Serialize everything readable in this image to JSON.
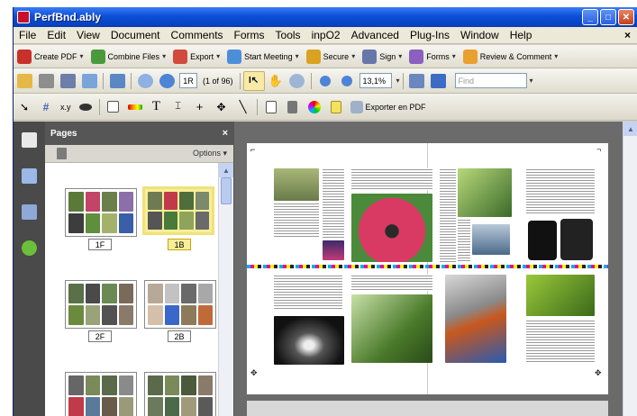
{
  "window": {
    "title": "PerfBnd.ably"
  },
  "menu": [
    "File",
    "Edit",
    "View",
    "Document",
    "Comments",
    "Forms",
    "Tools",
    "inpO2",
    "Advanced",
    "Plug-Ins",
    "Window",
    "Help"
  ],
  "menu_close": "×",
  "toolbar1": {
    "create_pdf": "Create PDF",
    "combine_files": "Combine Files",
    "export": "Export",
    "start_meeting": "Start Meeting",
    "secure": "Secure",
    "sign": "Sign",
    "forms": "Forms",
    "review_comment": "Review & Comment"
  },
  "toolbar2": {
    "page_value": "1R",
    "page_of": "(1 of 96)",
    "zoom_value": "13,1%",
    "find_placeholder": "Find"
  },
  "toolbar3": {
    "xy_label": "x.y",
    "exporter_label": "Exporter en PDF"
  },
  "pages_panel": {
    "title": "Pages",
    "close": "×",
    "options": "Options",
    "thumbs": [
      {
        "label": "1F",
        "selected": false
      },
      {
        "label": "1B",
        "selected": true
      },
      {
        "label": "2F",
        "selected": false
      },
      {
        "label": "2B",
        "selected": false
      },
      {
        "label": "",
        "selected": false
      },
      {
        "label": "",
        "selected": false
      }
    ]
  },
  "colors": {
    "title_bar": "#0a4fd8",
    "panel_dark": "#565656",
    "selection": "#f7ee9a",
    "workspace": "#6b6b6b"
  }
}
